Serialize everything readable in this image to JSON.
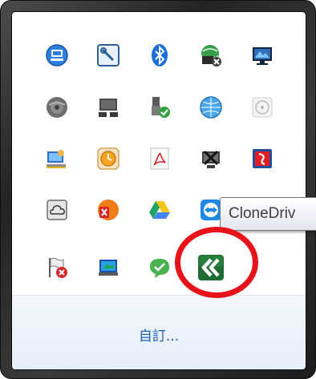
{
  "tray_icons": [
    {
      "row": 1,
      "name": "network-computer-icon"
    },
    {
      "row": 1,
      "name": "config-tool-icon"
    },
    {
      "row": 1,
      "name": "bluetooth-icon"
    },
    {
      "row": 1,
      "name": "network-status-icon"
    },
    {
      "row": 1,
      "name": "display-monitor-icon"
    },
    {
      "row": 2,
      "name": "speaker-disc-icon"
    },
    {
      "row": 2,
      "name": "printer-icon"
    },
    {
      "row": 2,
      "name": "safely-remove-hardware-icon"
    },
    {
      "row": 2,
      "name": "globe-icon"
    },
    {
      "row": 2,
      "name": "disc-drive-icon"
    },
    {
      "row": 3,
      "name": "computer-user-icon"
    },
    {
      "row": 3,
      "name": "alarm-clock-icon"
    },
    {
      "row": 3,
      "name": "acrobat-icon"
    },
    {
      "row": 3,
      "name": "disconnected-network-icon"
    },
    {
      "row": 3,
      "name": "red-app-icon"
    },
    {
      "row": 4,
      "name": "cloud-sync-icon"
    },
    {
      "row": 4,
      "name": "office-icon"
    },
    {
      "row": 4,
      "name": "google-drive-icon"
    },
    {
      "row": 4,
      "name": "teamviewer-icon"
    },
    {
      "row": 4,
      "name": "hidden-partial-icon"
    },
    {
      "row": 5,
      "name": "action-center-flag-icon"
    },
    {
      "row": 5,
      "name": "screen-capture-icon"
    },
    {
      "row": 5,
      "name": "line-chat-icon"
    },
    {
      "row": 5,
      "name": "clonedrive-icon"
    }
  ],
  "tooltip": {
    "text": "CloneDriv"
  },
  "footer": {
    "customize_label": "自訂..."
  },
  "colors": {
    "accent_link": "#1b5eb1",
    "annotation_red": "#e8121a",
    "clonedrive_green": "#1f6b33"
  }
}
